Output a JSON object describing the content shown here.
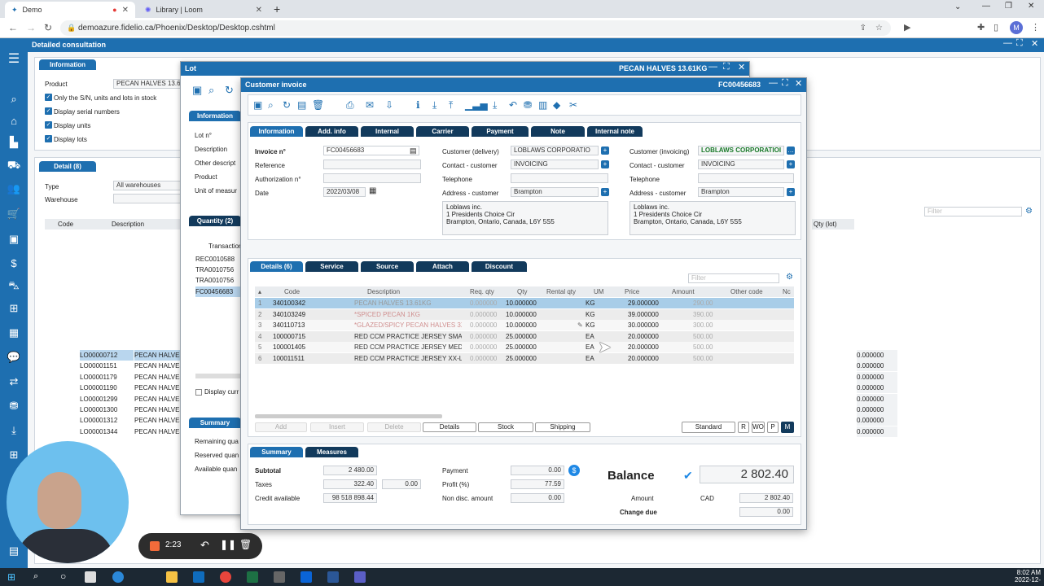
{
  "browser": {
    "tabs": [
      {
        "label": "Demo"
      },
      {
        "label": "Library | Loom"
      }
    ],
    "url": "demoazure.fidelio.ca/Phoenix/Desktop/Desktop.cshtml",
    "profile_initial": "M"
  },
  "consultation": {
    "title": "Detailed consultation",
    "info_tab": "Information",
    "product_label": "Product",
    "product_value": "PECAN HALVES 13.61",
    "checks": [
      "Only the S/N, units and lots in stock",
      "Display serial numbers",
      "Display units",
      "Display lots"
    ],
    "detail_tab": "Detail (8)",
    "type_label": "Type",
    "type_value": "All warehouses",
    "warehouse_label": "Warehouse",
    "filter_placeholder": "Filter",
    "col_code": "Code",
    "col_description": "Description",
    "col_qty_lot": "Qty (lot)",
    "rows": [
      {
        "code": "LO00000712",
        "description": "PECAN HALVES 13.61KG",
        "qty": "0.000000"
      },
      {
        "code": "LO00001151",
        "description": "PECAN HALVES 13.61KG",
        "qty": "0.000000"
      },
      {
        "code": "LO00001179",
        "description": "PECAN HALVES 13.61KG",
        "qty": "0.000000"
      },
      {
        "code": "LO00001190",
        "description": "PECAN HALVES 13.61KG",
        "qty": "0.000000"
      },
      {
        "code": "LO00001299",
        "description": "PECAN HALVES 13.61KG",
        "qty": "0.000000"
      },
      {
        "code": "LO00001300",
        "description": "PECAN HALVES 13.61KG",
        "qty": "0.000000"
      },
      {
        "code": "LO00001312",
        "description": "PECAN HALVES 13.61KG",
        "qty": "0.000000"
      },
      {
        "code": "LO00001344",
        "description": "PECAN HALVES 13.61KG",
        "qty": "0.000000"
      }
    ]
  },
  "lot": {
    "title": "Lot",
    "header_right": "PECAN HALVES 13.61KG",
    "info_tab": "Information",
    "labels": [
      "Lot n°",
      "Description",
      "Other descript",
      "Product",
      "Unit of measur"
    ],
    "qty_tab": "Quantity (2)",
    "trans_header": "Transaction",
    "transactions": [
      "REC0010588",
      "TRA0010756",
      "TRA0010756",
      "FC00456683"
    ],
    "display_check": "Display curr",
    "summary_tab": "Summary",
    "summary_labels": [
      "Remaining qua",
      "Reserved quan",
      "Available quan"
    ]
  },
  "invoice": {
    "title": "Customer invoice",
    "number": "FC00456683",
    "tabs": [
      "Information",
      "Add. info",
      "Internal",
      "Carrier",
      "Payment",
      "Note",
      "Internal note"
    ],
    "invoice_no_label": "Invoice n°",
    "invoice_no": "FC00456683",
    "reference_label": "Reference",
    "authorization_label": "Authorization n°",
    "date_label": "Date",
    "date": "2022/03/08",
    "cust_delivery_label": "Customer (delivery)",
    "cust_delivery": "LOBLAWS CORPORATIO",
    "contact_label": "Contact - customer",
    "contact_value": "INVOICING",
    "telephone_label": "Telephone",
    "address_label": "Address - customer",
    "address_value": "Brampton",
    "address_lines": [
      "Loblaws inc.",
      "1 Presidents Choice Cir",
      "Brampton, Ontario, Canada, L6Y 5S5"
    ],
    "cust_invoicing_label": "Customer (invoicing)",
    "cust_invoicing": "LOBLAWS CORPORATIOI",
    "detail_tabs": [
      "Details (6)",
      "Service",
      "Source",
      "Attach",
      "Discount"
    ],
    "filter_placeholder": "Filter",
    "columns": [
      "Code",
      "Description",
      "Req. qty",
      "Qty",
      "Rental qty",
      "UM",
      "Price",
      "Amount",
      "Other code",
      "Nc"
    ],
    "lines": [
      {
        "n": "1",
        "code": "340100342",
        "desc": "PECAN HALVES 13.61KG",
        "req": "0.000000",
        "qty": "10.000000",
        "um": "KG",
        "price": "29.000000",
        "amount": "290.00"
      },
      {
        "n": "2",
        "code": "340103249",
        "desc": "*SPICED PECAN 1KG",
        "req": "0.000000",
        "qty": "10.000000",
        "um": "KG",
        "price": "39.000000",
        "amount": "390.00"
      },
      {
        "n": "3",
        "code": "340110713",
        "desc": "*GLAZED/SPICY PECAN HALVES 3X",
        "req": "0.000000",
        "qty": "10.000000",
        "um": "KG",
        "price": "30.000000",
        "amount": "300.00"
      },
      {
        "n": "4",
        "code": "100000715",
        "desc": "RED CCM PRACTICE JERSEY SMALL",
        "req": "0.000000",
        "qty": "25.000000",
        "um": "EA",
        "price": "20.000000",
        "amount": "500.00"
      },
      {
        "n": "5",
        "code": "100001405",
        "desc": "RED CCM PRACTICE JERSEY MEDIU",
        "req": "0.000000",
        "qty": "25.000000",
        "um": "EA",
        "price": "20.000000",
        "amount": "500.00"
      },
      {
        "n": "6",
        "code": "100011511",
        "desc": "RED CCM PRACTICE JERSEY XX-LAR",
        "req": "0.000000",
        "qty": "25.000000",
        "um": "EA",
        "price": "20.000000",
        "amount": "500.00"
      }
    ],
    "action_buttons": [
      "Add",
      "Insert",
      "Delete",
      "Details",
      "Stock",
      "Shipping"
    ],
    "standard_button": "Standard",
    "mode_buttons": [
      "R",
      "WO",
      "P",
      "M"
    ],
    "summary_tabs": [
      "Summary",
      "Measures"
    ],
    "subtotal_label": "Subtotal",
    "subtotal": "2 480.00",
    "taxes_label": "Taxes",
    "taxes": "322.40",
    "taxes2": "0.00",
    "credit_label": "Credit available",
    "credit": "98 518 898.44",
    "payment_label": "Payment",
    "payment": "0.00",
    "profit_label": "Profit (%)",
    "profit": "77.59",
    "non_disc_label": "Non disc. amount",
    "non_disc": "0.00",
    "balance_label": "Balance",
    "balance": "2 802.40",
    "amount_label": "Amount",
    "currency": "CAD",
    "amount": "2 802.40",
    "change_label": "Change due",
    "change": "0.00"
  },
  "recorder": {
    "time": "2:23"
  },
  "taskbar": {
    "time": "8:02 AM",
    "date": "2022-12-"
  }
}
